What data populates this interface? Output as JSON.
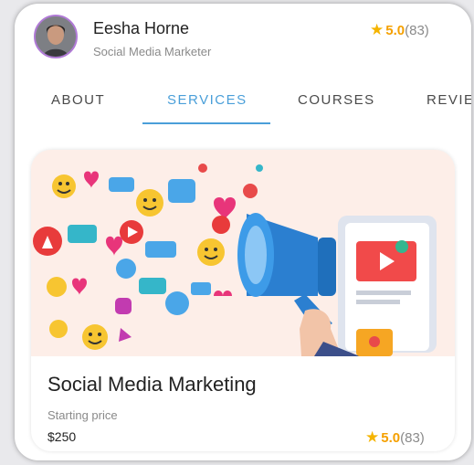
{
  "profile": {
    "name": "Eesha Horne",
    "title": "Social Media Marketer",
    "rating": "5.0",
    "reviews": "(83)"
  },
  "tabs": [
    {
      "label": "ABOUT",
      "active": false
    },
    {
      "label": "SERVICES",
      "active": true
    },
    {
      "label": "COURSES",
      "active": false
    },
    {
      "label": "REVIE",
      "active": false
    }
  ],
  "service": {
    "title": "Social Media Marketing",
    "price_label": "Starting price",
    "price": "$250",
    "rating": "5.0",
    "reviews": "(83)"
  },
  "colors": {
    "accent": "#4a9fd9",
    "star": "#f5b400",
    "avatar_ring": "#b07ad6"
  },
  "icons": [
    "star-icon",
    "megaphone-icon",
    "social-media-icons"
  ]
}
